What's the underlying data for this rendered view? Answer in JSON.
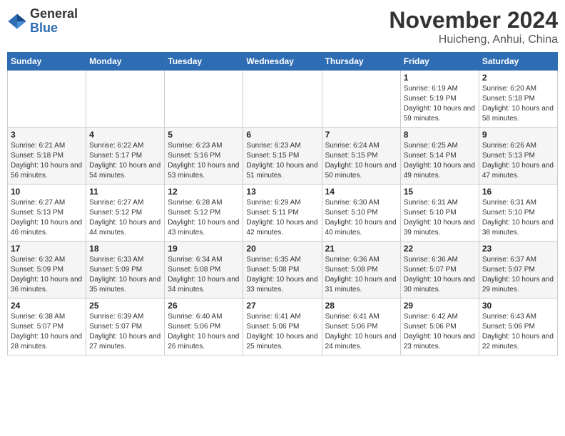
{
  "header": {
    "logo_general": "General",
    "logo_blue": "Blue",
    "month_title": "November 2024",
    "location": "Huicheng, Anhui, China"
  },
  "weekdays": [
    "Sunday",
    "Monday",
    "Tuesday",
    "Wednesday",
    "Thursday",
    "Friday",
    "Saturday"
  ],
  "weeks": [
    [
      {
        "day": "",
        "sunrise": "",
        "sunset": "",
        "daylight": ""
      },
      {
        "day": "",
        "sunrise": "",
        "sunset": "",
        "daylight": ""
      },
      {
        "day": "",
        "sunrise": "",
        "sunset": "",
        "daylight": ""
      },
      {
        "day": "",
        "sunrise": "",
        "sunset": "",
        "daylight": ""
      },
      {
        "day": "",
        "sunrise": "",
        "sunset": "",
        "daylight": ""
      },
      {
        "day": "1",
        "sunrise": "Sunrise: 6:19 AM",
        "sunset": "Sunset: 5:19 PM",
        "daylight": "Daylight: 10 hours and 59 minutes."
      },
      {
        "day": "2",
        "sunrise": "Sunrise: 6:20 AM",
        "sunset": "Sunset: 5:18 PM",
        "daylight": "Daylight: 10 hours and 58 minutes."
      }
    ],
    [
      {
        "day": "3",
        "sunrise": "Sunrise: 6:21 AM",
        "sunset": "Sunset: 5:18 PM",
        "daylight": "Daylight: 10 hours and 56 minutes."
      },
      {
        "day": "4",
        "sunrise": "Sunrise: 6:22 AM",
        "sunset": "Sunset: 5:17 PM",
        "daylight": "Daylight: 10 hours and 54 minutes."
      },
      {
        "day": "5",
        "sunrise": "Sunrise: 6:23 AM",
        "sunset": "Sunset: 5:16 PM",
        "daylight": "Daylight: 10 hours and 53 minutes."
      },
      {
        "day": "6",
        "sunrise": "Sunrise: 6:23 AM",
        "sunset": "Sunset: 5:15 PM",
        "daylight": "Daylight: 10 hours and 51 minutes."
      },
      {
        "day": "7",
        "sunrise": "Sunrise: 6:24 AM",
        "sunset": "Sunset: 5:15 PM",
        "daylight": "Daylight: 10 hours and 50 minutes."
      },
      {
        "day": "8",
        "sunrise": "Sunrise: 6:25 AM",
        "sunset": "Sunset: 5:14 PM",
        "daylight": "Daylight: 10 hours and 49 minutes."
      },
      {
        "day": "9",
        "sunrise": "Sunrise: 6:26 AM",
        "sunset": "Sunset: 5:13 PM",
        "daylight": "Daylight: 10 hours and 47 minutes."
      }
    ],
    [
      {
        "day": "10",
        "sunrise": "Sunrise: 6:27 AM",
        "sunset": "Sunset: 5:13 PM",
        "daylight": "Daylight: 10 hours and 46 minutes."
      },
      {
        "day": "11",
        "sunrise": "Sunrise: 6:27 AM",
        "sunset": "Sunset: 5:12 PM",
        "daylight": "Daylight: 10 hours and 44 minutes."
      },
      {
        "day": "12",
        "sunrise": "Sunrise: 6:28 AM",
        "sunset": "Sunset: 5:12 PM",
        "daylight": "Daylight: 10 hours and 43 minutes."
      },
      {
        "day": "13",
        "sunrise": "Sunrise: 6:29 AM",
        "sunset": "Sunset: 5:11 PM",
        "daylight": "Daylight: 10 hours and 42 minutes."
      },
      {
        "day": "14",
        "sunrise": "Sunrise: 6:30 AM",
        "sunset": "Sunset: 5:10 PM",
        "daylight": "Daylight: 10 hours and 40 minutes."
      },
      {
        "day": "15",
        "sunrise": "Sunrise: 6:31 AM",
        "sunset": "Sunset: 5:10 PM",
        "daylight": "Daylight: 10 hours and 39 minutes."
      },
      {
        "day": "16",
        "sunrise": "Sunrise: 6:31 AM",
        "sunset": "Sunset: 5:10 PM",
        "daylight": "Daylight: 10 hours and 38 minutes."
      }
    ],
    [
      {
        "day": "17",
        "sunrise": "Sunrise: 6:32 AM",
        "sunset": "Sunset: 5:09 PM",
        "daylight": "Daylight: 10 hours and 36 minutes."
      },
      {
        "day": "18",
        "sunrise": "Sunrise: 6:33 AM",
        "sunset": "Sunset: 5:09 PM",
        "daylight": "Daylight: 10 hours and 35 minutes."
      },
      {
        "day": "19",
        "sunrise": "Sunrise: 6:34 AM",
        "sunset": "Sunset: 5:08 PM",
        "daylight": "Daylight: 10 hours and 34 minutes."
      },
      {
        "day": "20",
        "sunrise": "Sunrise: 6:35 AM",
        "sunset": "Sunset: 5:08 PM",
        "daylight": "Daylight: 10 hours and 33 minutes."
      },
      {
        "day": "21",
        "sunrise": "Sunrise: 6:36 AM",
        "sunset": "Sunset: 5:08 PM",
        "daylight": "Daylight: 10 hours and 31 minutes."
      },
      {
        "day": "22",
        "sunrise": "Sunrise: 6:36 AM",
        "sunset": "Sunset: 5:07 PM",
        "daylight": "Daylight: 10 hours and 30 minutes."
      },
      {
        "day": "23",
        "sunrise": "Sunrise: 6:37 AM",
        "sunset": "Sunset: 5:07 PM",
        "daylight": "Daylight: 10 hours and 29 minutes."
      }
    ],
    [
      {
        "day": "24",
        "sunrise": "Sunrise: 6:38 AM",
        "sunset": "Sunset: 5:07 PM",
        "daylight": "Daylight: 10 hours and 28 minutes."
      },
      {
        "day": "25",
        "sunrise": "Sunrise: 6:39 AM",
        "sunset": "Sunset: 5:07 PM",
        "daylight": "Daylight: 10 hours and 27 minutes."
      },
      {
        "day": "26",
        "sunrise": "Sunrise: 6:40 AM",
        "sunset": "Sunset: 5:06 PM",
        "daylight": "Daylight: 10 hours and 26 minutes."
      },
      {
        "day": "27",
        "sunrise": "Sunrise: 6:41 AM",
        "sunset": "Sunset: 5:06 PM",
        "daylight": "Daylight: 10 hours and 25 minutes."
      },
      {
        "day": "28",
        "sunrise": "Sunrise: 6:41 AM",
        "sunset": "Sunset: 5:06 PM",
        "daylight": "Daylight: 10 hours and 24 minutes."
      },
      {
        "day": "29",
        "sunrise": "Sunrise: 6:42 AM",
        "sunset": "Sunset: 5:06 PM",
        "daylight": "Daylight: 10 hours and 23 minutes."
      },
      {
        "day": "30",
        "sunrise": "Sunrise: 6:43 AM",
        "sunset": "Sunset: 5:06 PM",
        "daylight": "Daylight: 10 hours and 22 minutes."
      }
    ]
  ]
}
